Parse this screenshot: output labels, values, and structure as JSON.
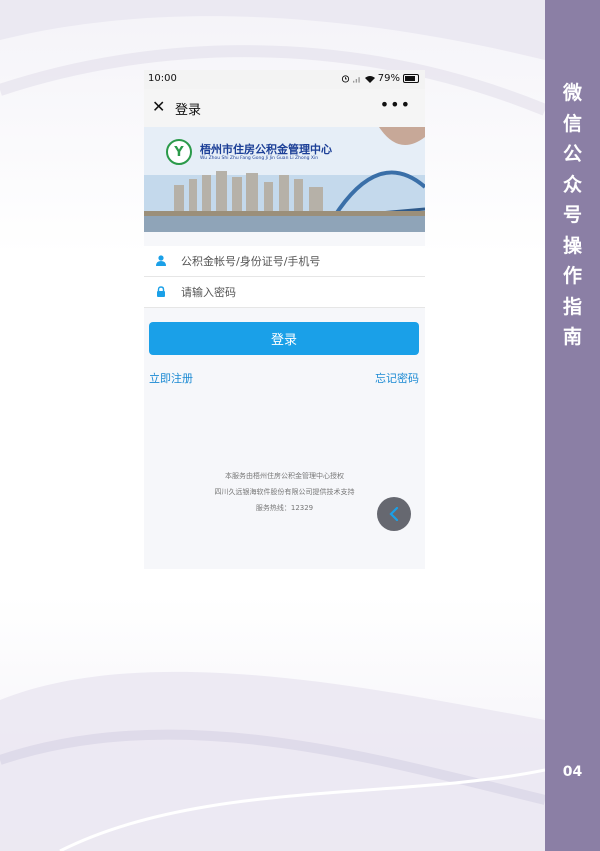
{
  "sidebar": {
    "title_chars": [
      "微",
      "信",
      "公",
      "众",
      "号",
      "操",
      "作",
      "指",
      "南"
    ],
    "page_number": "04",
    "color": "#8b7fa5"
  },
  "status_bar": {
    "time": "10:00",
    "battery": "79%",
    "icons": [
      "alarm-icon",
      "signal-icon",
      "wifi-icon",
      "battery-icon"
    ]
  },
  "nav_bar": {
    "close_icon": "close-icon",
    "title": "登录",
    "more_icon": "more-icon"
  },
  "banner": {
    "org_name": "梧州市住房公积金管理中心",
    "org_pinyin": "Wu Zhou Shi Zhu Fang Gong Ji Jin Guan Li Zhong Xin"
  },
  "form": {
    "account_placeholder": "公积金帐号/身份证号/手机号",
    "password_placeholder": "请输入密码",
    "login_label": "登录",
    "register_label": "立即注册",
    "forgot_label": "忘记密码",
    "accent_color": "#1aa0e8"
  },
  "footer": {
    "line1": "本服务由梧州住房公积金管理中心授权",
    "line2": "四川久远银海软件股份有限公司提供技术支持",
    "line3": "服务热线：12329"
  }
}
